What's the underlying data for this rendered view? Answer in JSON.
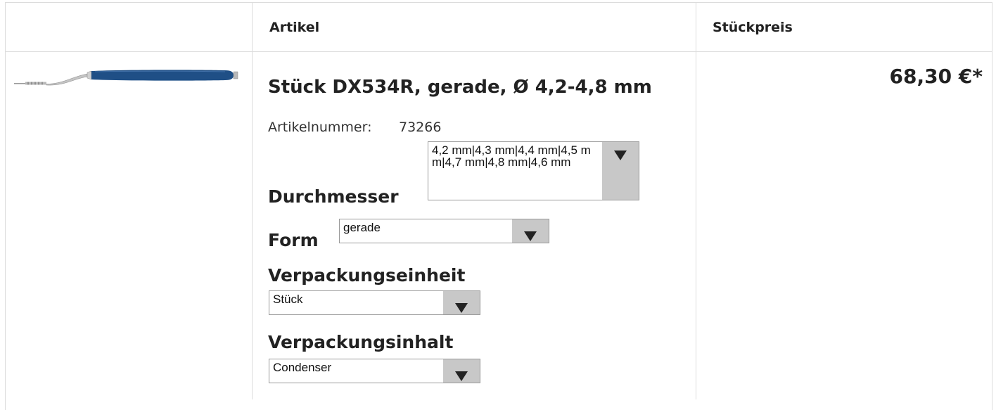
{
  "table": {
    "header": {
      "image_col": "",
      "article_col": "Artikel",
      "price_col": "Stückpreis"
    },
    "row": {
      "title": "Stück DX534R, gerade, Ø 4,2-4,8 mm",
      "article_number_label": "Artikelnummer:",
      "article_number": "73266",
      "price": "68,30 €*",
      "image_alt": "blue handled dental instrument with curved tip",
      "options": {
        "durchmesser": {
          "label": "Durchmesser",
          "value": "4,2 mm|4,3 mm|4,4 mm|4,5 mm|4,7 mm|4,8 mm|4,6 mm"
        },
        "form": {
          "label": "Form",
          "value": "gerade"
        },
        "verpackungseinheit": {
          "label": "Verpackungseinheit",
          "value": "Stück"
        },
        "verpackungsinhalt": {
          "label": "Verpackungsinhalt",
          "value": "Condenser"
        }
      }
    }
  },
  "colors": {
    "border": "#dcdcdc",
    "instrument_handle": "#1f4f86",
    "select_arrow_bg": "#c8c8c8"
  }
}
